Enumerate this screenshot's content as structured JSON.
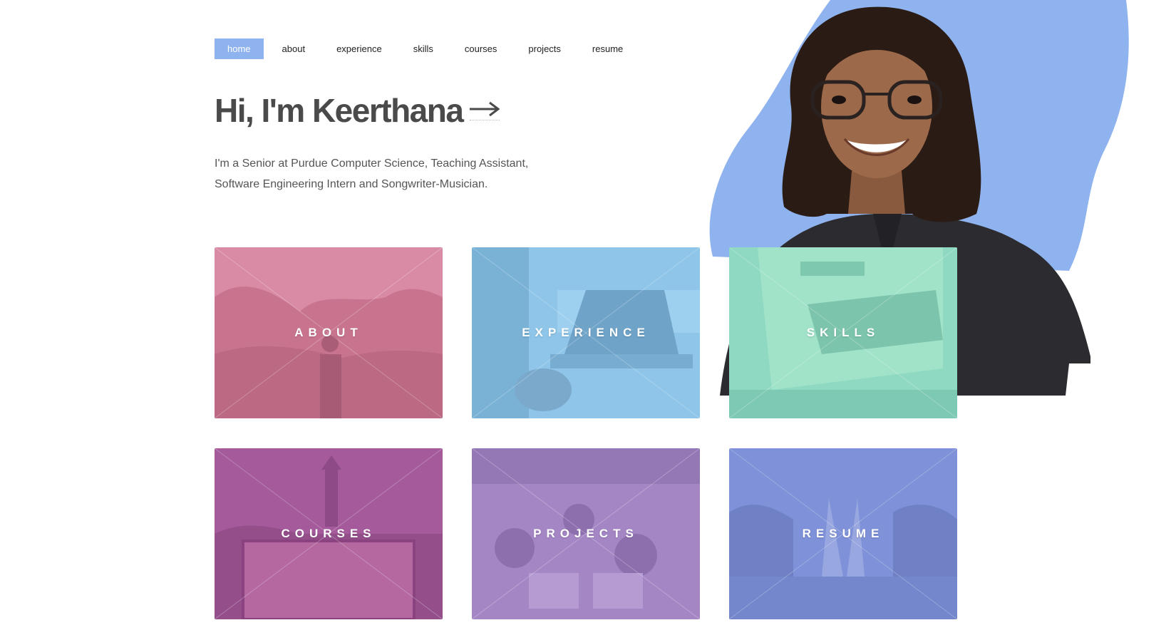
{
  "nav": {
    "items": [
      {
        "label": "home",
        "active": true
      },
      {
        "label": "about"
      },
      {
        "label": "experience"
      },
      {
        "label": "skills"
      },
      {
        "label": "courses"
      },
      {
        "label": "projects"
      },
      {
        "label": "resume"
      }
    ]
  },
  "hero": {
    "title": "Hi, I'm Keerthana",
    "arrow_icon": "right-arrow-icon",
    "subtitle": "I'm a Senior at Purdue Computer Science, Teaching Assistant, Software Engineering Intern and Songwriter-Musician."
  },
  "colors": {
    "accent": "#8fb3ee",
    "about": "#d98aa4",
    "experience": "#8ec5e8",
    "skills": "#8fd9c2",
    "courses": "#a55a9b",
    "projects": "#a486c4",
    "resume": "#7f91d8"
  },
  "cards": {
    "about": "ABOUT",
    "experience": "EXPERIENCE",
    "skills": "SKILLS",
    "courses": "COURSES",
    "projects": "PROJECTS",
    "resume": "RESUME"
  }
}
